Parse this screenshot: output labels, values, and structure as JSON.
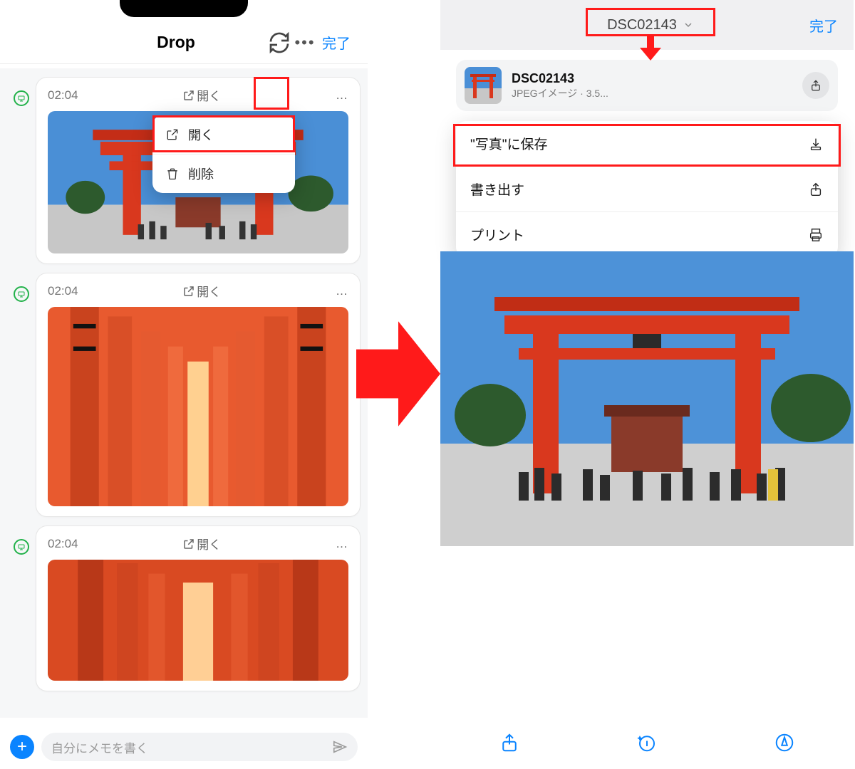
{
  "left": {
    "title": "Drop",
    "done": "完了",
    "items": [
      {
        "time": "02:04",
        "open": "開く",
        "more": "…",
        "photo": "torii-scene"
      },
      {
        "time": "02:04",
        "open": "開く",
        "more": "…",
        "photo": "torii-tunnel"
      },
      {
        "time": "02:04",
        "open": "開く",
        "more": "…",
        "photo": "torii-tunnel"
      }
    ],
    "context_menu": {
      "open": "開く",
      "delete": "削除"
    },
    "compose_placeholder": "自分にメモを書く"
  },
  "right": {
    "header_title": "DSC02143",
    "done": "完了",
    "file": {
      "name": "DSC02143",
      "info": "JPEGイメージ · 3.5..."
    },
    "actions": {
      "save_photos": "\"写真\"に保存",
      "export": "書き出す",
      "print": "プリント"
    }
  }
}
